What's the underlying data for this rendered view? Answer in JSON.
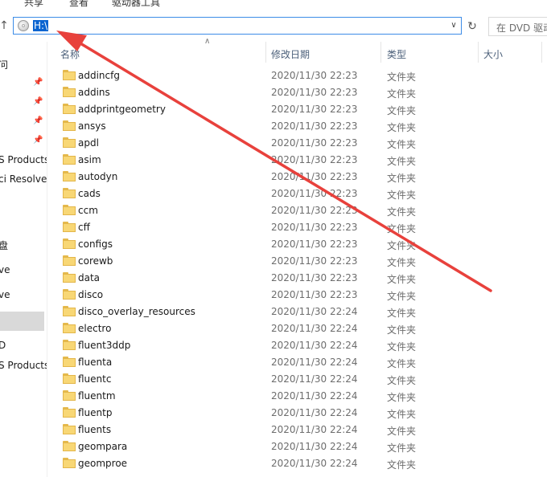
{
  "ribbon": {
    "tabs": [
      "共享",
      "查看",
      "驱动器工具"
    ]
  },
  "address_bar": {
    "path": "H:\\",
    "search_placeholder": "在 DVD 驱动"
  },
  "nav_pane": {
    "items": [
      "问",
      "S Products",
      "ci Resolve",
      "盘",
      "ve",
      "ve",
      "D",
      "S Products"
    ]
  },
  "columns": {
    "name": "名称",
    "date": "修改日期",
    "type": "类型",
    "size": "大小"
  },
  "files": [
    {
      "name": "addincfg",
      "date": "2020/11/30 22:23",
      "type": "文件夹"
    },
    {
      "name": "addins",
      "date": "2020/11/30 22:23",
      "type": "文件夹"
    },
    {
      "name": "addprintgeometry",
      "date": "2020/11/30 22:23",
      "type": "文件夹"
    },
    {
      "name": "ansys",
      "date": "2020/11/30 22:23",
      "type": "文件夹"
    },
    {
      "name": "apdl",
      "date": "2020/11/30 22:23",
      "type": "文件夹"
    },
    {
      "name": "asim",
      "date": "2020/11/30 22:23",
      "type": "文件夹"
    },
    {
      "name": "autodyn",
      "date": "2020/11/30 22:23",
      "type": "文件夹"
    },
    {
      "name": "cads",
      "date": "2020/11/30 22:23",
      "type": "文件夹"
    },
    {
      "name": "ccm",
      "date": "2020/11/30 22:23",
      "type": "文件夹"
    },
    {
      "name": "cff",
      "date": "2020/11/30 22:23",
      "type": "文件夹"
    },
    {
      "name": "configs",
      "date": "2020/11/30 22:23",
      "type": "文件夹"
    },
    {
      "name": "corewb",
      "date": "2020/11/30 22:23",
      "type": "文件夹"
    },
    {
      "name": "data",
      "date": "2020/11/30 22:23",
      "type": "文件夹"
    },
    {
      "name": "disco",
      "date": "2020/11/30 22:23",
      "type": "文件夹"
    },
    {
      "name": "disco_overlay_resources",
      "date": "2020/11/30 22:24",
      "type": "文件夹"
    },
    {
      "name": "electro",
      "date": "2020/11/30 22:24",
      "type": "文件夹"
    },
    {
      "name": "fluent3ddp",
      "date": "2020/11/30 22:24",
      "type": "文件夹"
    },
    {
      "name": "fluenta",
      "date": "2020/11/30 22:24",
      "type": "文件夹"
    },
    {
      "name": "fluentc",
      "date": "2020/11/30 22:24",
      "type": "文件夹"
    },
    {
      "name": "fluentm",
      "date": "2020/11/30 22:24",
      "type": "文件夹"
    },
    {
      "name": "fluentp",
      "date": "2020/11/30 22:24",
      "type": "文件夹"
    },
    {
      "name": "fluents",
      "date": "2020/11/30 22:24",
      "type": "文件夹"
    },
    {
      "name": "geompara",
      "date": "2020/11/30 22:24",
      "type": "文件夹"
    },
    {
      "name": "geomproe",
      "date": "2020/11/30 22:24",
      "type": "文件夹"
    }
  ],
  "annotation": {
    "arrow_color": "#e8413c"
  }
}
